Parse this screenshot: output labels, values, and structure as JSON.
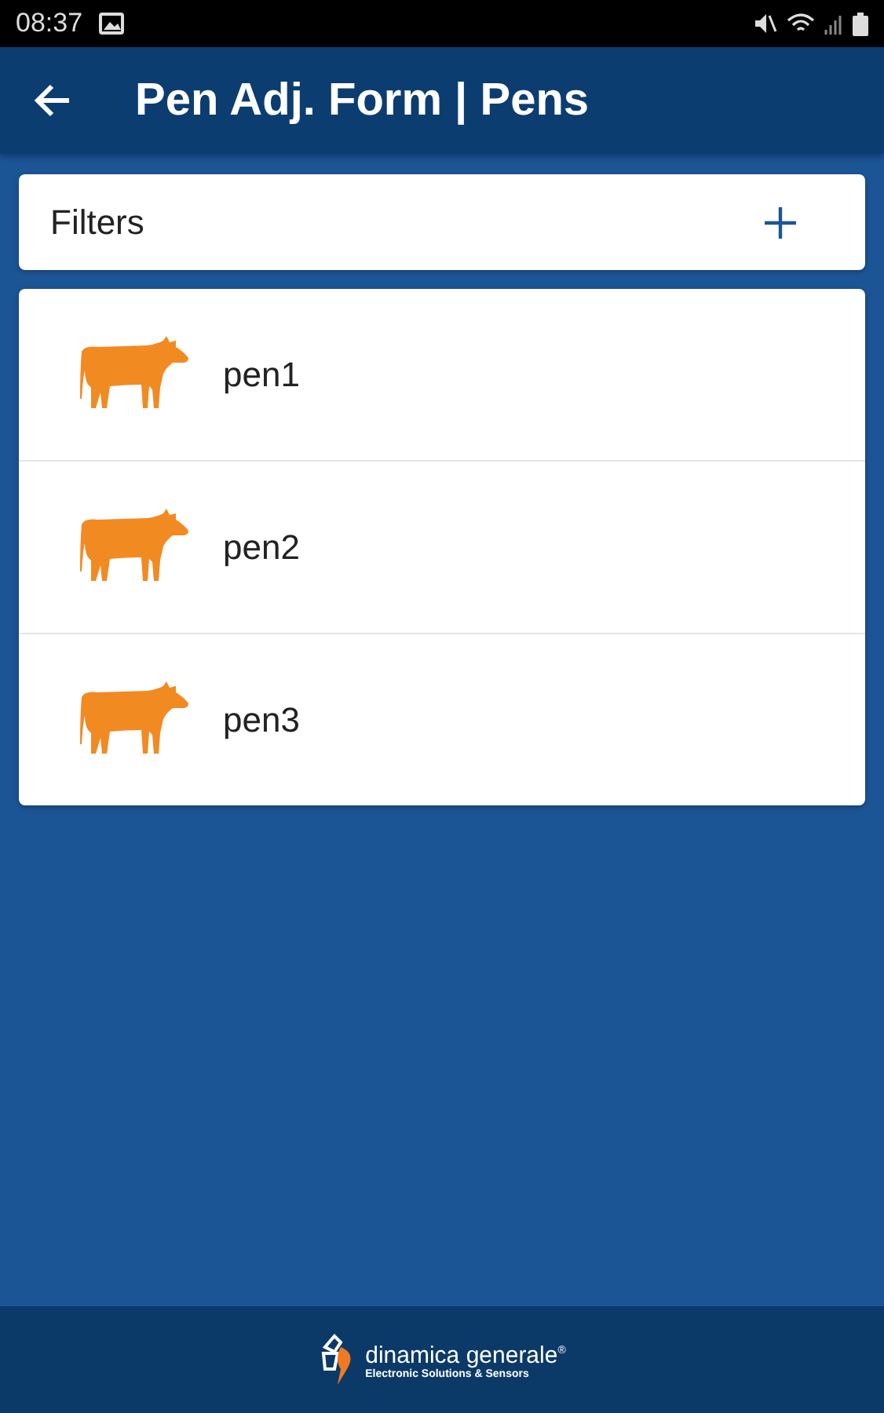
{
  "status_bar": {
    "time": "08:37"
  },
  "app_bar": {
    "title": "Pen Adj. Form | Pens"
  },
  "filters": {
    "label": "Filters"
  },
  "pens": [
    {
      "name": "pen1"
    },
    {
      "name": "pen2"
    },
    {
      "name": "pen3"
    }
  ],
  "footer": {
    "brand": "dinamica generale",
    "registered": "®",
    "tagline": "Electronic Solutions & Sensors"
  }
}
